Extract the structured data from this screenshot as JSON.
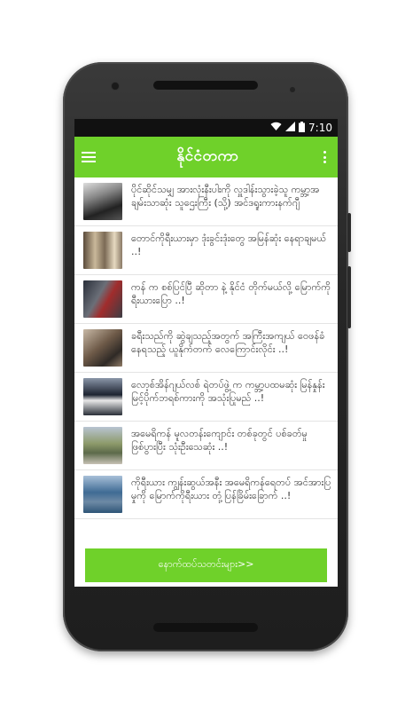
{
  "status_bar": {
    "time": "7:10"
  },
  "app": {
    "title": "နိုင်ငံတကာ",
    "more_button": "နောက်ထပ်သတင်းများ>>"
  },
  "news": [
    {
      "headline": "ပိုင်ဆိုင်သမျှ အားလုံးနီးပါးကို လှူဒါန်းသွားခဲ့သူ ကမ္ဘာ့အချမ်းသာဆုံး သူဌေးကြီး (သို့) အင်ဒရူးကားနက်ဂျီ",
      "thumb": "portrait-photo"
    },
    {
      "headline": "တောင်ကိုရီးယားမှာ ဒုံးခွင်းဒုံးတွေ အမြန်ဆုံး နေရာချမယ် ..!",
      "thumb": "missile-photo"
    },
    {
      "headline": "ကန် က စစ်ပြင်ပြီ ဆိုတာ နဲ့ နိုင်ငံ တိုက်မယ်လို့ မြောက်ကိုရီးယားပြော ..!",
      "thumb": "military-photo"
    },
    {
      "headline": "ခရီးသည်ကို ဆွဲချသည့်အတွက် အကြီးအကျယ် ဝေဖန်ခံနေရသည့် ယူနိုက်တက် လေကြောင်းလိုင်း ..!",
      "thumb": "plane-cabin-photo"
    },
    {
      "headline": "လော့စ်အိန်ဂျယ်လစ် ရဲတပ်ဖွဲ့ က ကမ္ဘာ့ပထမဆုံး မြန်နှုန်းမြင့်ပိုက်ဘရစ်ကားကို အသုံးပြုမည် ..!",
      "thumb": "police-car-photo"
    },
    {
      "headline": "အမေရိကန် မူလတန်းကျောင်း တစ်ခုတွင် ပစ်ခတ်မှု ဖြစ်ပွားပြီး သုံးဦးသေဆုံး ..!",
      "thumb": "school-photo"
    },
    {
      "headline": "ကိုရီးယား ကျွန်းဆွယ်အနီး အမေရိကန်ရေတပ် အင်အားပြမှုကို မြောက်ကိုရီးယား တုံ့ပြန်ခြိမ်းခြောက် ..!",
      "thumb": "navy-ship-photo"
    }
  ]
}
